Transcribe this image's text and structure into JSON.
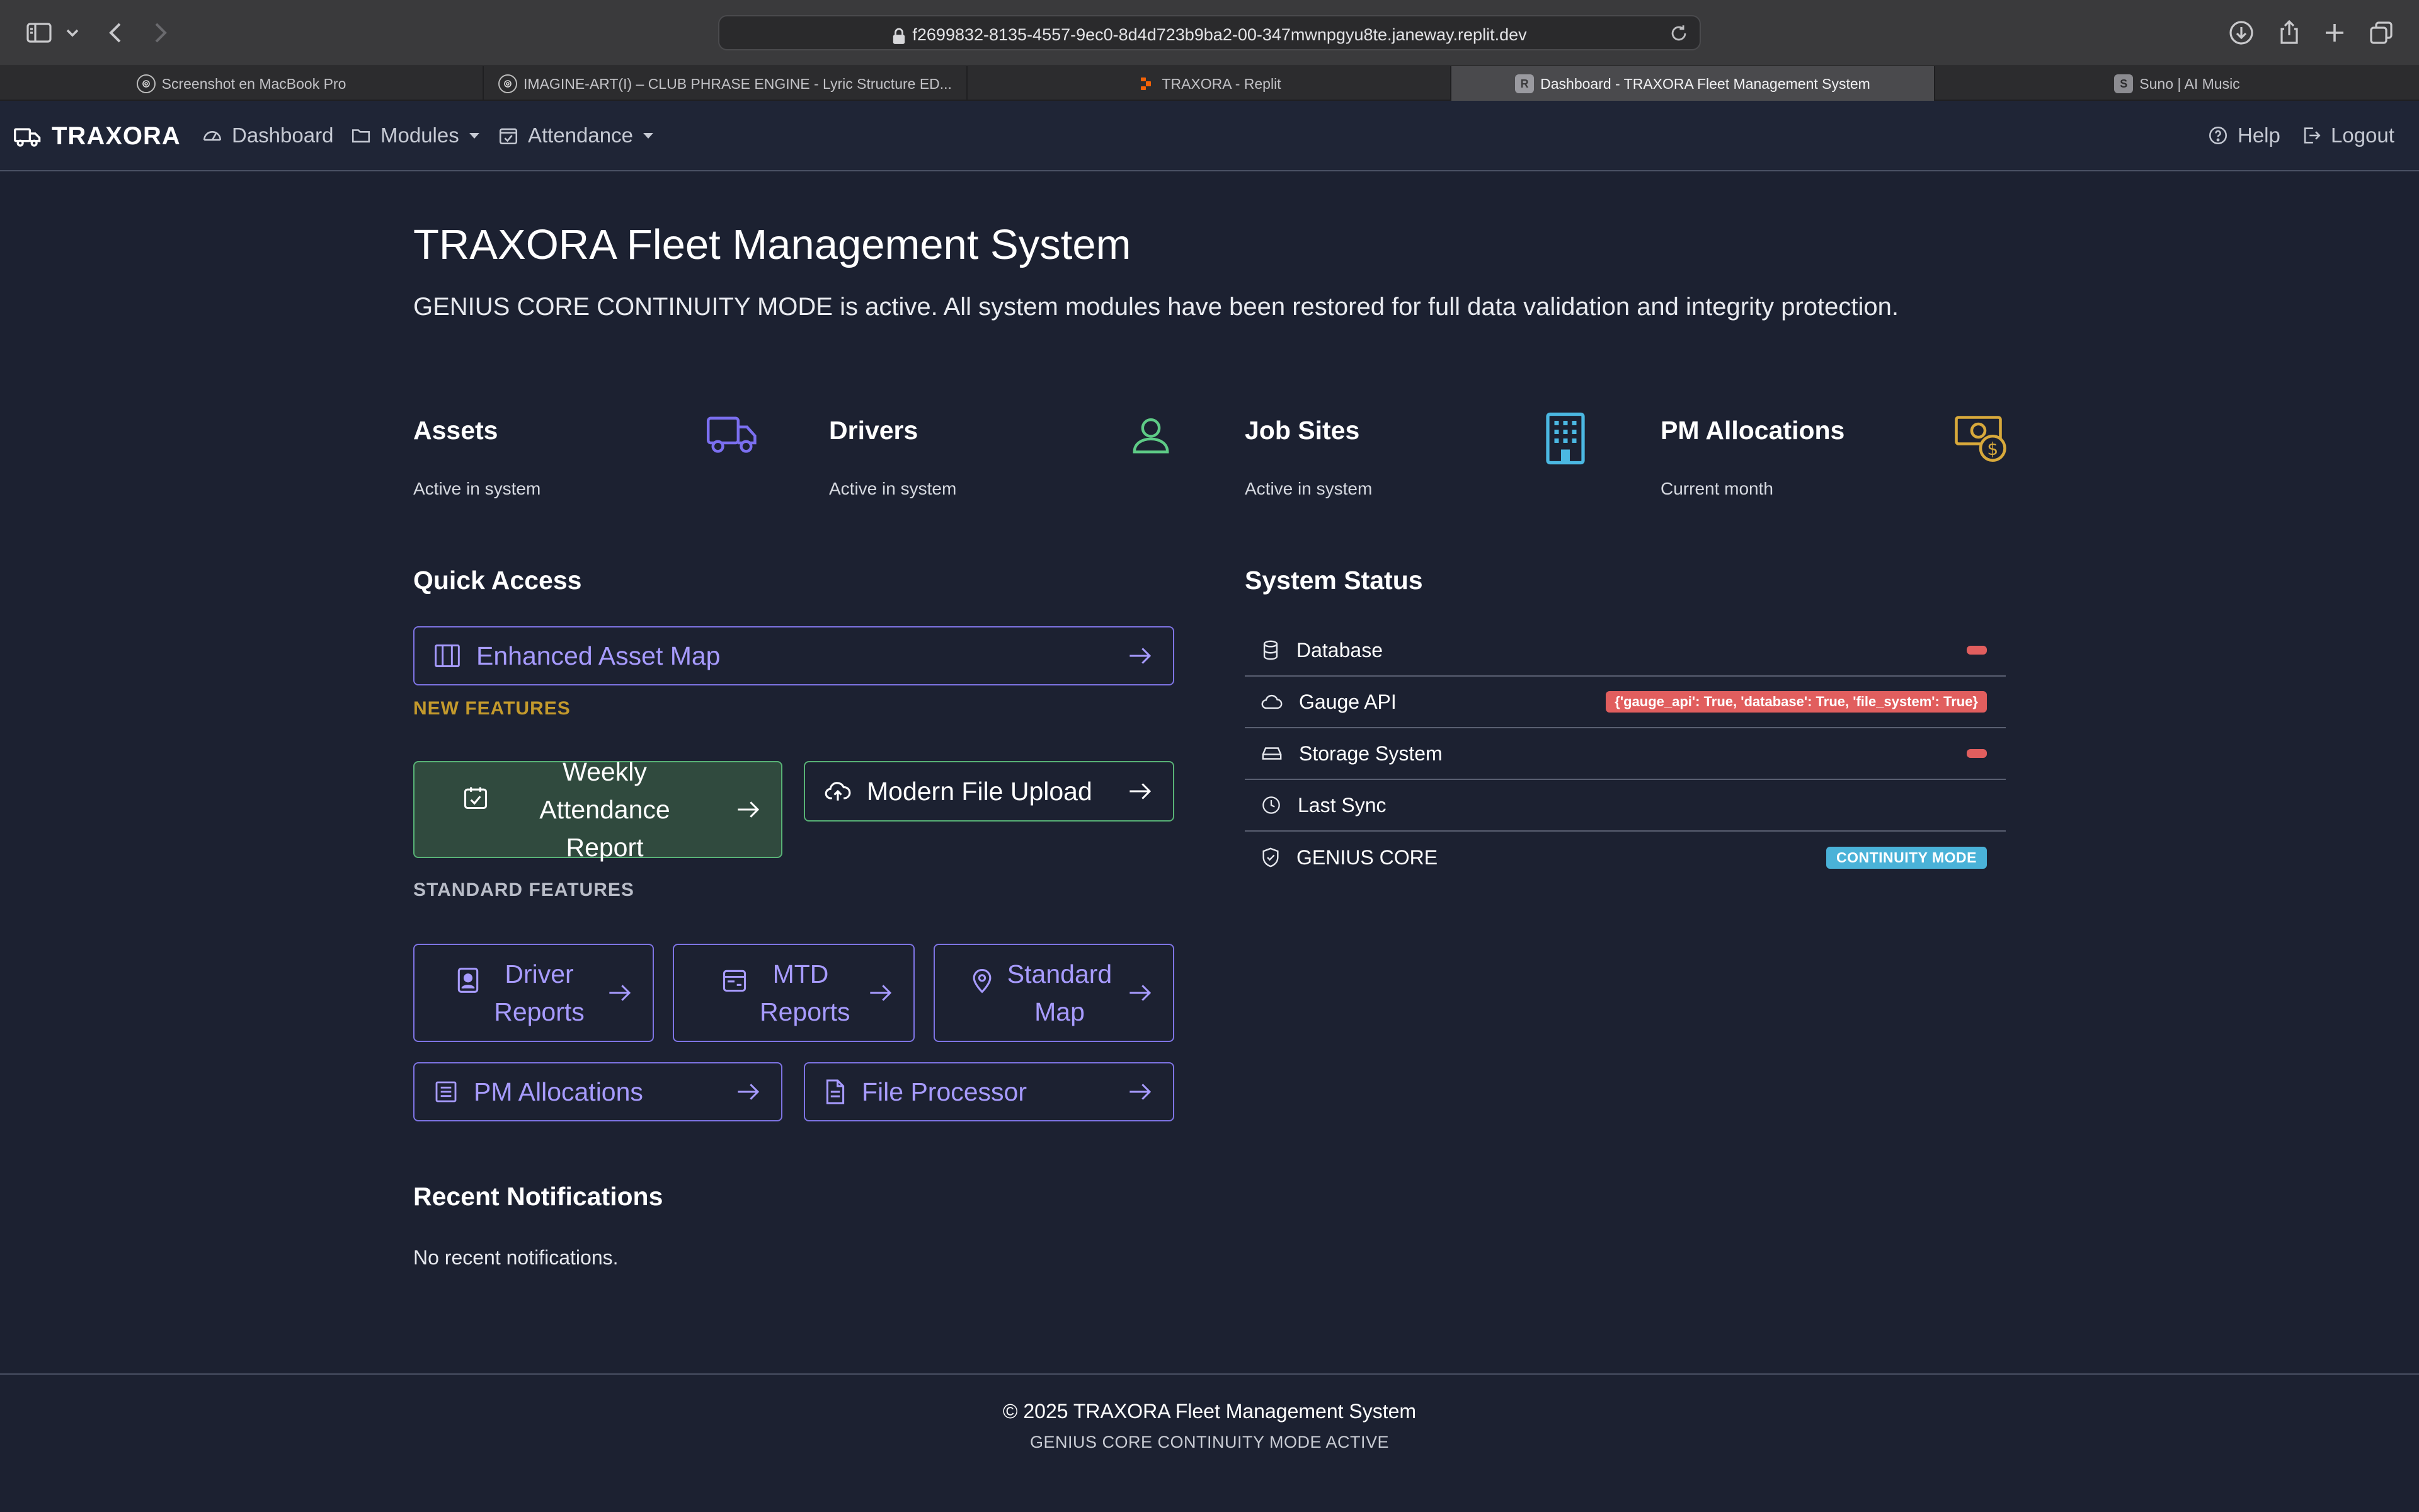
{
  "browser": {
    "url": "f2699832-8135-4557-9ec0-8d4d723b9ba2-00-347mwnpgyu8te.janeway.replit.dev",
    "tabs": [
      {
        "label": "Screenshot en MacBook Pro",
        "active": false
      },
      {
        "label": "IMAGINE-ART(I) – CLUB PHRASE ENGINE - Lyric Structure ED...",
        "active": false
      },
      {
        "label": "TRAXORA - Replit",
        "active": false
      },
      {
        "label": "Dashboard - TRAXORA Fleet Management System",
        "active": true
      },
      {
        "label": "Suno | AI Music",
        "active": false
      }
    ]
  },
  "nav": {
    "brand": "TRAXORA",
    "items": {
      "dashboard": "Dashboard",
      "modules": "Modules",
      "attendance": "Attendance"
    },
    "help": "Help",
    "logout": "Logout"
  },
  "header": {
    "title": "TRAXORA Fleet Management System",
    "lead": "GENIUS CORE CONTINUITY MODE is active. All system modules have been restored for full data validation and integrity protection."
  },
  "stats": [
    {
      "title": "Assets",
      "subtitle": "Active in system",
      "icon": "truck-icon",
      "color": "#7b6ff0"
    },
    {
      "title": "Drivers",
      "subtitle": "Active in system",
      "icon": "person-icon",
      "color": "#5ecb86"
    },
    {
      "title": "Job Sites",
      "subtitle": "Active in system",
      "icon": "building-icon",
      "color": "#4bb8e2"
    },
    {
      "title": "PM Allocations",
      "subtitle": "Current month",
      "icon": "cash-icon",
      "color": "#d8a93b"
    }
  ],
  "quick_access": {
    "title": "Quick Access",
    "enhanced_map": "Enhanced Asset Map",
    "new_features_label": "NEW FEATURES",
    "weekly_attendance": "Weekly Attendance Report",
    "modern_upload": "Modern File Upload",
    "standard_features_label": "STANDARD FEATURES",
    "driver_reports": "Driver Reports",
    "mtd_reports": "MTD Reports",
    "standard_map": "Standard Map",
    "pm_allocations": "PM Allocations",
    "file_processor": "File Processor"
  },
  "system_status": {
    "title": "System Status",
    "rows": [
      {
        "label": "Database",
        "icon": "database-icon"
      },
      {
        "label": "Gauge API",
        "icon": "cloud-icon",
        "badge": "{'gauge_api': True, 'database': True, 'file_system': True}"
      },
      {
        "label": "Storage System",
        "icon": "drive-icon"
      },
      {
        "label": "Last Sync",
        "icon": "clock-icon"
      },
      {
        "label": "GENIUS CORE",
        "icon": "shield-check-icon",
        "badge": "CONTINUITY MODE"
      }
    ]
  },
  "notifications": {
    "title": "Recent Notifications",
    "empty": "No recent notifications."
  },
  "footer": {
    "copyright": "© 2025 TRAXORA Fleet Management System",
    "mode": "GENIUS CORE CONTINUITY MODE ACTIVE"
  },
  "colors": {
    "accent": "#7e74e4",
    "green": "#58b276",
    "new_features": "#c49a2c",
    "danger": "#e15e5e",
    "info": "#4ab2d8"
  }
}
